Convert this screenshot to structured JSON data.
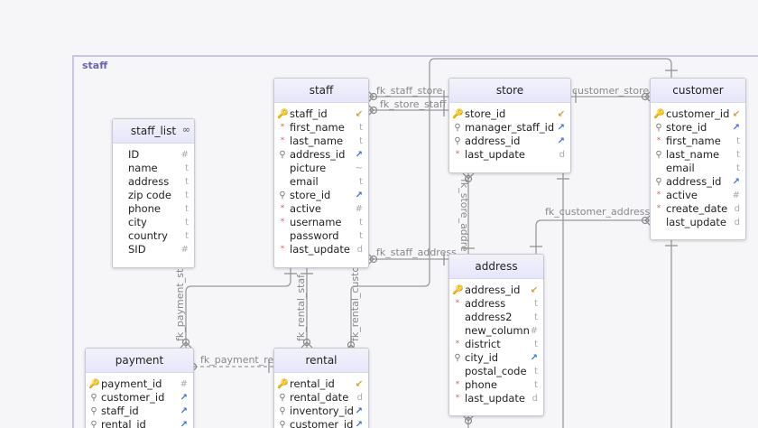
{
  "group": {
    "label": "staff"
  },
  "tables": {
    "staff_list": {
      "title": "staff_list",
      "view_icon": "∞",
      "columns": [
        {
          "name": "ID",
          "icon": "",
          "type": "#"
        },
        {
          "name": "name",
          "icon": "",
          "type": "t"
        },
        {
          "name": "address",
          "icon": "",
          "type": "t"
        },
        {
          "name": "zip code",
          "icon": "",
          "type": "t"
        },
        {
          "name": "phone",
          "icon": "",
          "type": "t"
        },
        {
          "name": "city",
          "icon": "",
          "type": "t"
        },
        {
          "name": "country",
          "icon": "",
          "type": "t"
        },
        {
          "name": "SID",
          "icon": "",
          "type": "#"
        }
      ]
    },
    "staff": {
      "title": "staff",
      "columns": [
        {
          "name": "staff_id",
          "icon": "pk",
          "type": "pkarrow"
        },
        {
          "name": "first_name",
          "icon": "nn",
          "type": "t"
        },
        {
          "name": "last_name",
          "icon": "nn",
          "type": "t"
        },
        {
          "name": "address_id",
          "icon": "fk",
          "type": "fkarrow"
        },
        {
          "name": "picture",
          "icon": "",
          "type": "~"
        },
        {
          "name": "email",
          "icon": "",
          "type": "t"
        },
        {
          "name": "store_id",
          "icon": "fk",
          "type": "fkarrow"
        },
        {
          "name": "active",
          "icon": "nn",
          "type": "#"
        },
        {
          "name": "username",
          "icon": "nn",
          "type": "t"
        },
        {
          "name": "password",
          "icon": "",
          "type": "t"
        },
        {
          "name": "last_update",
          "icon": "nn",
          "type": "d"
        }
      ]
    },
    "store": {
      "title": "store",
      "columns": [
        {
          "name": "store_id",
          "icon": "pk",
          "type": "pkarrow"
        },
        {
          "name": "manager_staff_id",
          "icon": "fk",
          "type": "fkarrow"
        },
        {
          "name": "address_id",
          "icon": "fk",
          "type": "fkarrow"
        },
        {
          "name": "last_update",
          "icon": "nn",
          "type": "d"
        }
      ]
    },
    "customer": {
      "title": "customer",
      "columns": [
        {
          "name": "customer_id",
          "icon": "pk",
          "type": "pkarrow"
        },
        {
          "name": "store_id",
          "icon": "fk",
          "type": "fkarrow"
        },
        {
          "name": "first_name",
          "icon": "nn",
          "type": "t"
        },
        {
          "name": "last_name",
          "icon": "fk",
          "type": "t"
        },
        {
          "name": "email",
          "icon": "",
          "type": "t"
        },
        {
          "name": "address_id",
          "icon": "fk",
          "type": "fkarrow"
        },
        {
          "name": "active",
          "icon": "nn",
          "type": "#"
        },
        {
          "name": "create_date",
          "icon": "nn",
          "type": "d"
        },
        {
          "name": "last_update",
          "icon": "",
          "type": "d"
        }
      ]
    },
    "address": {
      "title": "address",
      "columns": [
        {
          "name": "address_id",
          "icon": "pk",
          "type": "pkarrow"
        },
        {
          "name": "address",
          "icon": "nn",
          "type": "t"
        },
        {
          "name": "address2",
          "icon": "",
          "type": "t"
        },
        {
          "name": "new_column",
          "icon": "",
          "type": "#"
        },
        {
          "name": "district",
          "icon": "nn",
          "type": "t"
        },
        {
          "name": "city_id",
          "icon": "fk",
          "type": "fkarrow"
        },
        {
          "name": "postal_code",
          "icon": "",
          "type": "t"
        },
        {
          "name": "phone",
          "icon": "nn",
          "type": "t"
        },
        {
          "name": "last_update",
          "icon": "nn",
          "type": "d"
        }
      ]
    },
    "payment": {
      "title": "payment",
      "columns": [
        {
          "name": "payment_id",
          "icon": "pk",
          "type": "#"
        },
        {
          "name": "customer_id",
          "icon": "fk",
          "type": "fkarrow"
        },
        {
          "name": "staff_id",
          "icon": "fk",
          "type": "fkarrow"
        },
        {
          "name": "rental_id",
          "icon": "fk",
          "type": "fkarrow"
        }
      ]
    },
    "rental": {
      "title": "rental",
      "columns": [
        {
          "name": "rental_id",
          "icon": "pk",
          "type": "pkarrow"
        },
        {
          "name": "rental_date",
          "icon": "fk",
          "type": "d"
        },
        {
          "name": "inventory_id",
          "icon": "fk",
          "type": "fkarrow"
        },
        {
          "name": "customer_id",
          "icon": "fk",
          "type": "fkarrow"
        }
      ]
    }
  },
  "relations": {
    "fk_staff_store": "fk_staff_store",
    "fk_store_staff": "fk_store_staff",
    "customer_store": "customer_store",
    "fk_customer_address": "fk_customer_address",
    "fk_staff_address": "fk_staff_address",
    "fk_store_address": "fk_store_addre",
    "fk_payment_staff": "fk_payment_sta",
    "fk_payment_rental": "fk_payment_ren",
    "fk_rental_staff": "fk_rental_staf",
    "fk_rental_customer": "fk_rental_custo"
  },
  "icons": {
    "pk": "key-icon",
    "fk": "foreign-key-icon",
    "nn": "not-null-marker",
    "view": "view-link-icon"
  }
}
